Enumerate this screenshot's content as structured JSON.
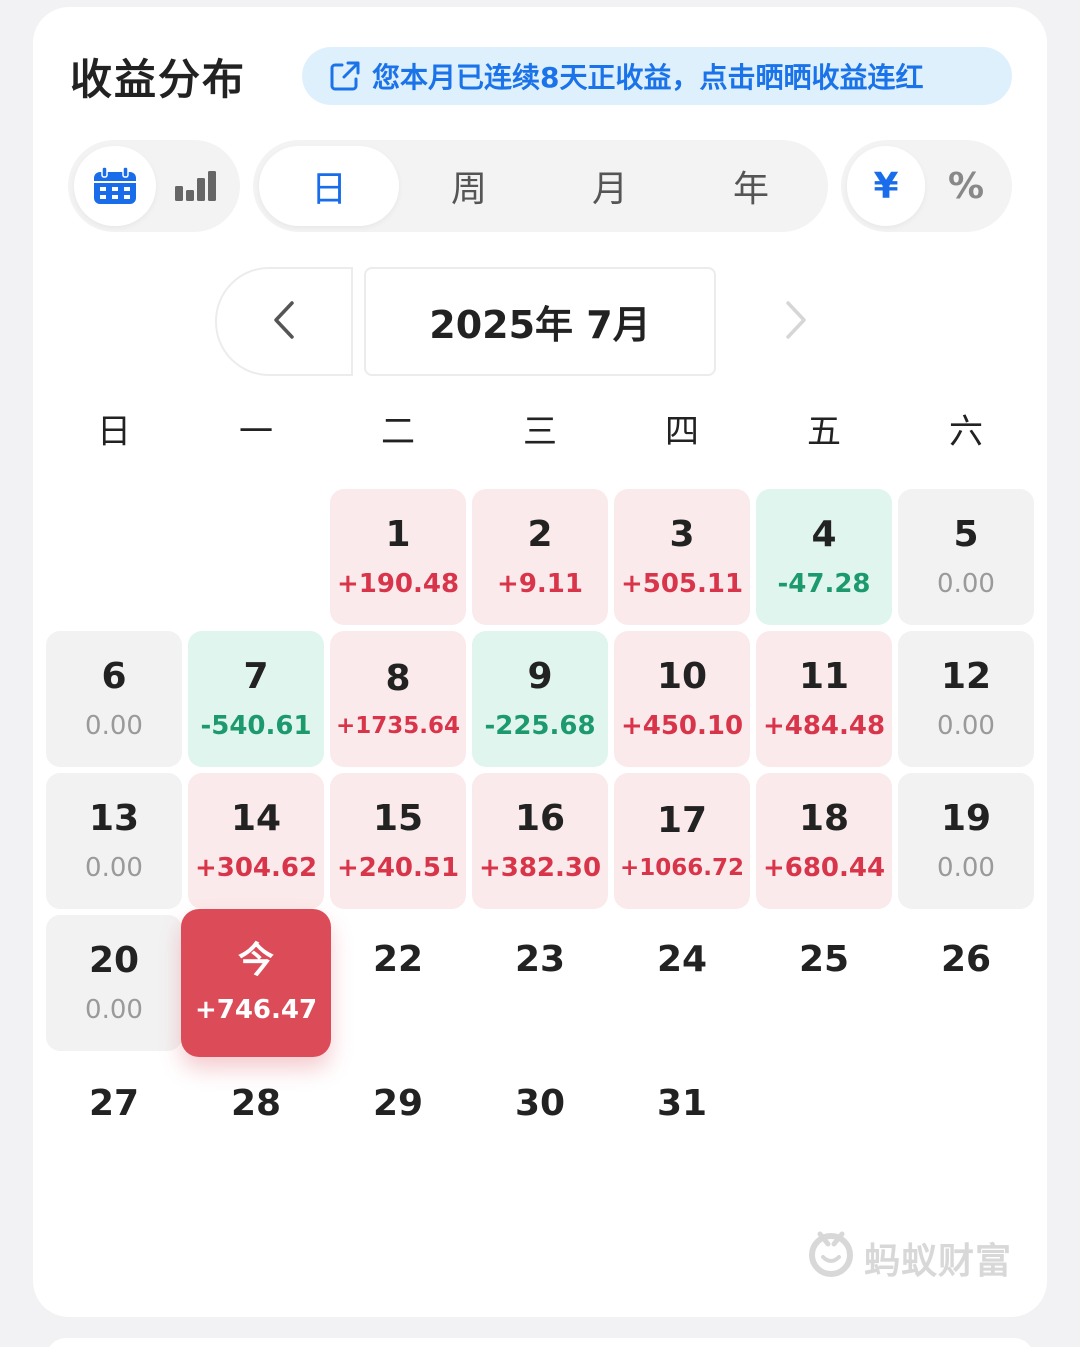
{
  "header": {
    "title": "收益分布",
    "banner_text": "您本月已连续8天正收益，点击晒晒收益连红"
  },
  "view_toggle": {
    "options": [
      "calendar-icon",
      "bar-chart-icon"
    ],
    "active": "calendar-icon"
  },
  "period_tabs": {
    "items": [
      "日",
      "周",
      "月",
      "年"
    ],
    "active": "日"
  },
  "unit_toggle": {
    "items": [
      "¥",
      "%"
    ],
    "active": "¥"
  },
  "month_nav": {
    "label": "2025年 7月",
    "prev_enabled": true,
    "next_enabled": false
  },
  "weekdays": [
    "日",
    "一",
    "二",
    "三",
    "四",
    "五",
    "六"
  ],
  "calendar": {
    "days": [
      {
        "day": "1",
        "value": "+190.48",
        "state": "pos"
      },
      {
        "day": "2",
        "value": "+9.11",
        "state": "pos"
      },
      {
        "day": "3",
        "value": "+505.11",
        "state": "pos"
      },
      {
        "day": "4",
        "value": "-47.28",
        "state": "neg"
      },
      {
        "day": "5",
        "value": "0.00",
        "state": "zero"
      },
      {
        "day": "6",
        "value": "0.00",
        "state": "zero"
      },
      {
        "day": "7",
        "value": "-540.61",
        "state": "neg"
      },
      {
        "day": "8",
        "value": "+1735.64",
        "state": "pos"
      },
      {
        "day": "9",
        "value": "-225.68",
        "state": "neg"
      },
      {
        "day": "10",
        "value": "+450.10",
        "state": "pos"
      },
      {
        "day": "11",
        "value": "+484.48",
        "state": "pos"
      },
      {
        "day": "12",
        "value": "0.00",
        "state": "zero"
      },
      {
        "day": "13",
        "value": "0.00",
        "state": "zero"
      },
      {
        "day": "14",
        "value": "+304.62",
        "state": "pos"
      },
      {
        "day": "15",
        "value": "+240.51",
        "state": "pos"
      },
      {
        "day": "16",
        "value": "+382.30",
        "state": "pos"
      },
      {
        "day": "17",
        "value": "+1066.72",
        "state": "pos"
      },
      {
        "day": "18",
        "value": "+680.44",
        "state": "pos"
      },
      {
        "day": "19",
        "value": "0.00",
        "state": "zero"
      },
      {
        "day": "20",
        "value": "0.00",
        "state": "zero"
      },
      {
        "day": "今",
        "value": "+746.47",
        "state": "today"
      },
      {
        "day": "22",
        "value": "",
        "state": "blank"
      },
      {
        "day": "23",
        "value": "",
        "state": "blank"
      },
      {
        "day": "24",
        "value": "",
        "state": "blank"
      },
      {
        "day": "25",
        "value": "",
        "state": "blank"
      },
      {
        "day": "26",
        "value": "",
        "state": "blank"
      },
      {
        "day": "27",
        "value": "",
        "state": "blank"
      },
      {
        "day": "28",
        "value": "",
        "state": "blank"
      },
      {
        "day": "29",
        "value": "",
        "state": "blank"
      },
      {
        "day": "30",
        "value": "",
        "state": "blank"
      },
      {
        "day": "31",
        "value": "",
        "state": "blank"
      }
    ]
  },
  "watermark": {
    "text": "蚂蚁财富"
  },
  "colors": {
    "accent_blue": "#1a6dea",
    "gain_red": "#d8344a",
    "loss_green": "#1c9a6e",
    "today_red": "#dc4c58"
  }
}
